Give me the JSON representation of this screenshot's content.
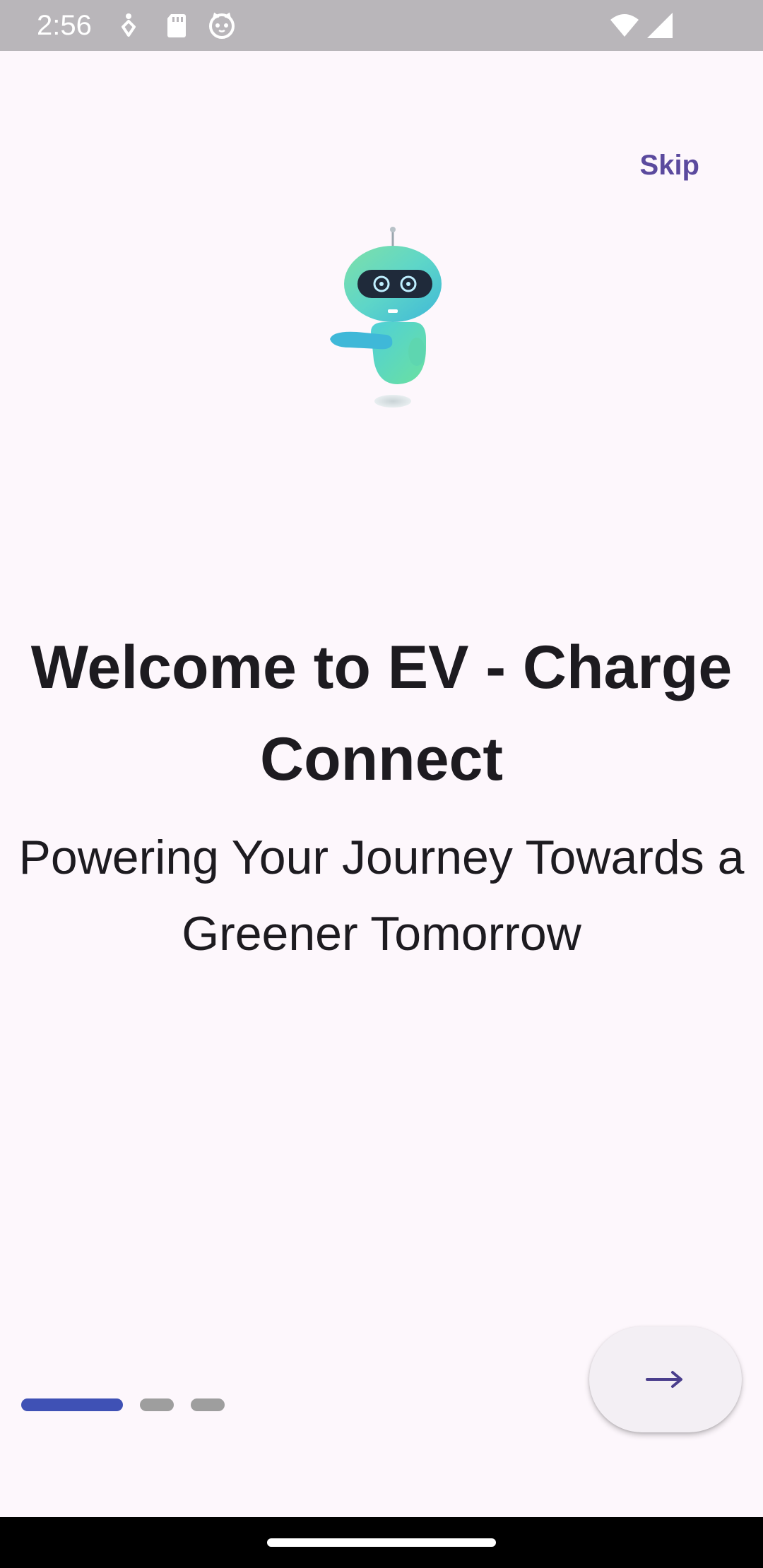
{
  "status_bar": {
    "time": "2:56",
    "icons": [
      "accessibility-icon",
      "sd-card-icon",
      "cat-face-icon",
      "wifi-icon",
      "signal-icon"
    ]
  },
  "onboarding": {
    "skip_label": "Skip",
    "title": "Welcome to EV - Charge Connect",
    "subtitle": "Powering Your Journey Towards a Greener Tomorrow",
    "page_indicator": {
      "total_pages": 3,
      "current_page": 1
    },
    "next_button_icon": "arrow-right-icon"
  },
  "colors": {
    "background": "#FDF7FC",
    "accent": "#5B4A9E",
    "indicator_active": "#3F51B5",
    "indicator_inactive": "#9E9E9E",
    "status_bar": "#B9B6BA"
  }
}
